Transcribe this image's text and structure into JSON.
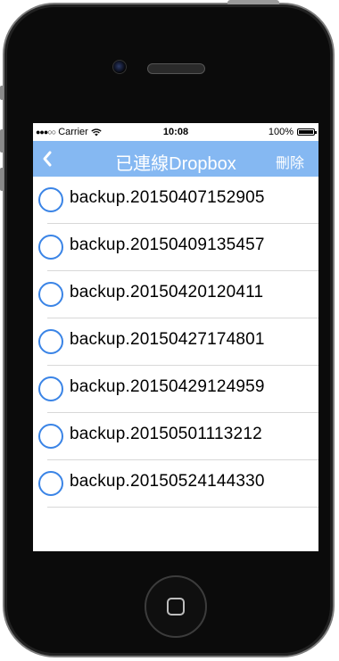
{
  "status_bar": {
    "carrier": "Carrier",
    "time": "10:08",
    "battery": "100%"
  },
  "nav": {
    "title": "已連線Dropbox",
    "delete_label": "刪除",
    "back_icon": "chevron-left-icon"
  },
  "backups": [
    {
      "name": "backup.20150407152905"
    },
    {
      "name": "backup.20150409135457"
    },
    {
      "name": "backup.20150420120411"
    },
    {
      "name": "backup.20150427174801"
    },
    {
      "name": "backup.20150429124959"
    },
    {
      "name": "backup.20150501113212"
    },
    {
      "name": "backup.20150524144330"
    }
  ],
  "colors": {
    "nav_background": "#85b8f2",
    "radio_border": "#3a84e6"
  }
}
